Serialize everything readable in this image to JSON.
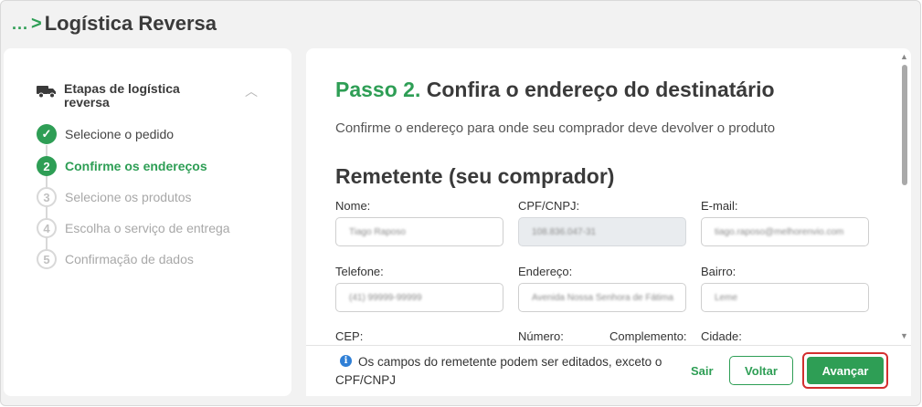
{
  "header": {
    "ellipsis": "...",
    "chevron": ">",
    "title": "Logística Reversa"
  },
  "steps": {
    "title": "Etapas de logística reversa",
    "items": [
      {
        "number": "✓",
        "label": "Selecione o pedido",
        "state": "done"
      },
      {
        "number": "2",
        "label": "Confirme os endereços",
        "state": "active"
      },
      {
        "number": "3",
        "label": "Selecione os produtos",
        "state": "todo"
      },
      {
        "number": "4",
        "label": "Escolha o serviço de entrega",
        "state": "todo"
      },
      {
        "number": "5",
        "label": "Confirmação de dados",
        "state": "todo"
      }
    ]
  },
  "main": {
    "step_number": "Passo 2.",
    "step_title": "Confira o endereço do destinatário",
    "subtitle": "Confirme o endereço para onde seu comprador deve devolver o produto",
    "section_title": "Remetente (seu comprador)",
    "fields": {
      "nome": {
        "label": "Nome:",
        "value": "Tiago Raposo"
      },
      "cpf": {
        "label": "CPF/CNPJ:",
        "value": "108.836.047-31"
      },
      "email": {
        "label": "E-mail:",
        "value": "tiago.raposo@melhorenvio.com"
      },
      "telefone": {
        "label": "Telefone:",
        "value": "(41) 99999-99999"
      },
      "endereco": {
        "label": "Endereço:",
        "value": "Avenida Nossa Senhora de Fátima"
      },
      "bairro": {
        "label": "Bairro:",
        "value": "Leme"
      },
      "cep": {
        "label": "CEP:"
      },
      "numero": {
        "label": "Número:"
      },
      "complemento": {
        "label": "Complemento:"
      },
      "cidade": {
        "label": "Cidade:"
      }
    }
  },
  "footer": {
    "info_icon": "i",
    "info_text": "Os campos do remetente podem ser editados, exceto o CPF/CNPJ",
    "sair_label": "Sair",
    "voltar_label": "Voltar",
    "avancar_label": "Avançar"
  },
  "scrollbar": {
    "up_arrow": "▲",
    "down_arrow": "▼"
  },
  "colors": {
    "accent": "#2e9e55",
    "highlight": "#d32f2f",
    "info": "#2f7fd6"
  }
}
